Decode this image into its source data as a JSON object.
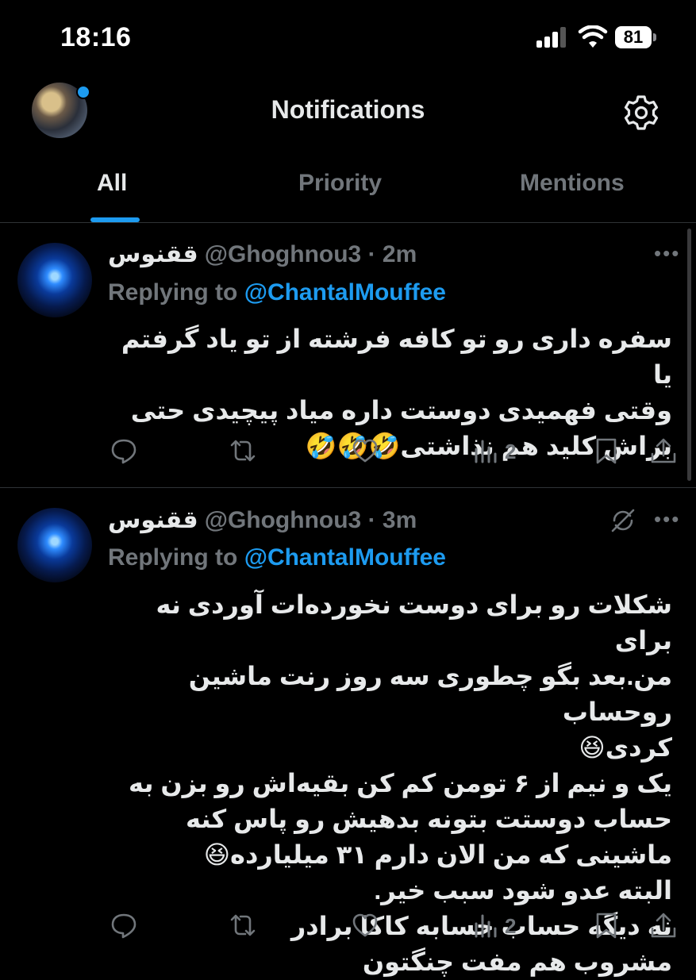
{
  "status_bar": {
    "time": "18:16",
    "battery": "81"
  },
  "header": {
    "title": "Notifications"
  },
  "tabs": [
    {
      "label": "All",
      "active": true
    },
    {
      "label": "Priority",
      "active": false
    },
    {
      "label": "Mentions",
      "active": false
    }
  ],
  "tweets": [
    {
      "name": "ققنوس",
      "handle": "@Ghoghnou3",
      "time": "· 2m",
      "reply_prefix": "Replying to",
      "reply_to": "@ChantalMouffee",
      "text": "سفره داری رو تو کافه فرشته از تو یاد گرفتم یا\nوقتی فهمیدی دوستت داره میاد پیچیدی حتی\nبراش کلید هم نذاشتی🤣🤣🤣",
      "views": "2"
    },
    {
      "name": "ققنوس",
      "handle": "@Ghoghnou3",
      "time": "· 3m",
      "reply_prefix": "Replying to",
      "reply_to": "@ChantalMouffee",
      "text": "شکلات رو برای دوست نخورده‌ات آوردی نه برای\nمن.بعد بگو چطوری سه روز رنت ماشین روحساب\nکردی😆\nیک و نیم از ۶ تومن کم کن بقیه‌اش رو بزن به\nحساب دوستت بتونه بدهیش رو پاس کنه\nماشینی که من الان دارم ۳۱ میلیارده😆\nالبته عدو شود سبب خیر.\nنه دیگه حساب حسابه کاکا برادر\nمشروب هم مفت چنگتون",
      "views": "2"
    }
  ],
  "icons": {
    "reply": "speech-bubble-icon",
    "retweet": "retweet-icon",
    "like": "heart-icon",
    "views": "bar-chart-icon",
    "bookmark": "bookmark-icon",
    "share": "share-icon",
    "more": "more-icon",
    "mute": "mute-notification-icon",
    "settings": "gear-icon"
  },
  "colors": {
    "accent": "#1d9bf0",
    "background": "#000000",
    "secondary_text": "#71767b"
  }
}
